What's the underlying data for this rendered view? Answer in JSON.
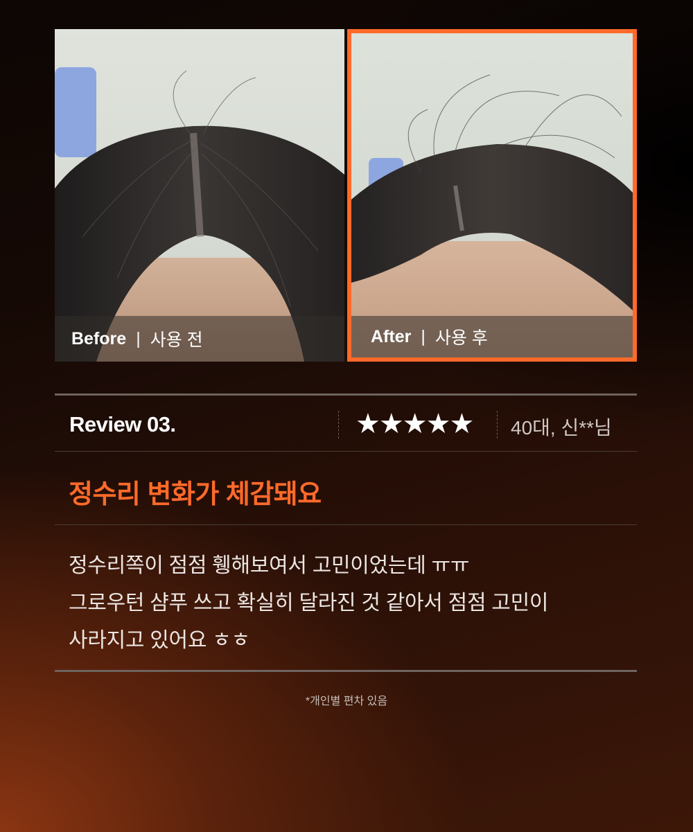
{
  "photos": {
    "before": {
      "label": "Before",
      "separator": "|",
      "text": "사용 전"
    },
    "after": {
      "label": "After",
      "separator": "|",
      "text": "사용 후"
    }
  },
  "review": {
    "title": "Review 03.",
    "stars": "★★★★★",
    "rating": 5,
    "reviewer": "40대, 신**님",
    "headline": "정수리 변화가 체감돼요",
    "body": [
      "정수리쪽이 점점 휑해보여서 고민이었는데 ㅠㅠ",
      "그로우턴 샴푸 쓰고 확실히 달라진 것 같아서 점점 고민이",
      "사라지고 있어요 ㅎㅎ"
    ]
  },
  "footnote": "*개인별 편차 있음",
  "colors": {
    "accent": "#ff6a2a",
    "rule": "#6e6460"
  }
}
